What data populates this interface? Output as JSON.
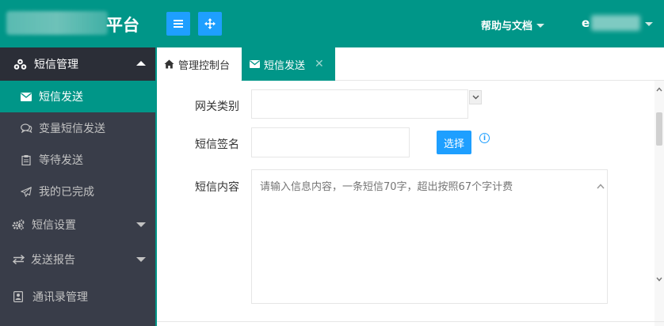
{
  "header": {
    "logo_text": "平台",
    "help_label": "帮助与文档",
    "user_initial": "e",
    "menu_toggle_icon": "hamburger-icon",
    "fullscreen_icon": "move-icon"
  },
  "sidebar": {
    "items": [
      {
        "label": "短信管理",
        "icon": "cubes-icon"
      },
      {
        "label": "短信发送",
        "icon": "envelope-icon"
      },
      {
        "label": "变量短信发送",
        "icon": "comments-icon"
      },
      {
        "label": "等待发送",
        "icon": "clipboard-icon"
      },
      {
        "label": "我的已完成",
        "icon": "paper-plane-icon"
      },
      {
        "label": "短信设置",
        "icon": "gears-icon"
      },
      {
        "label": "发送报告",
        "icon": "exchange-icon"
      },
      {
        "label": "通讯录管理",
        "icon": "address-book-icon"
      }
    ]
  },
  "tabs": [
    {
      "label": "管理控制台",
      "icon": "home-icon"
    },
    {
      "label": "短信发送",
      "icon": "envelope-icon",
      "close": "✕"
    }
  ],
  "form": {
    "gateway_label": "网关类别",
    "gateway_value": "",
    "signature_label": "短信签名",
    "signature_value": "",
    "choose_button": "选择",
    "info_icon_text": "i",
    "content_label": "短信内容",
    "content_placeholder": "请输入信息内容，一条短信70字，超出按照67个字计费"
  },
  "colors": {
    "primary": "#009688",
    "sidebar_bg": "#393d49",
    "button_blue": "#1e9fff"
  }
}
